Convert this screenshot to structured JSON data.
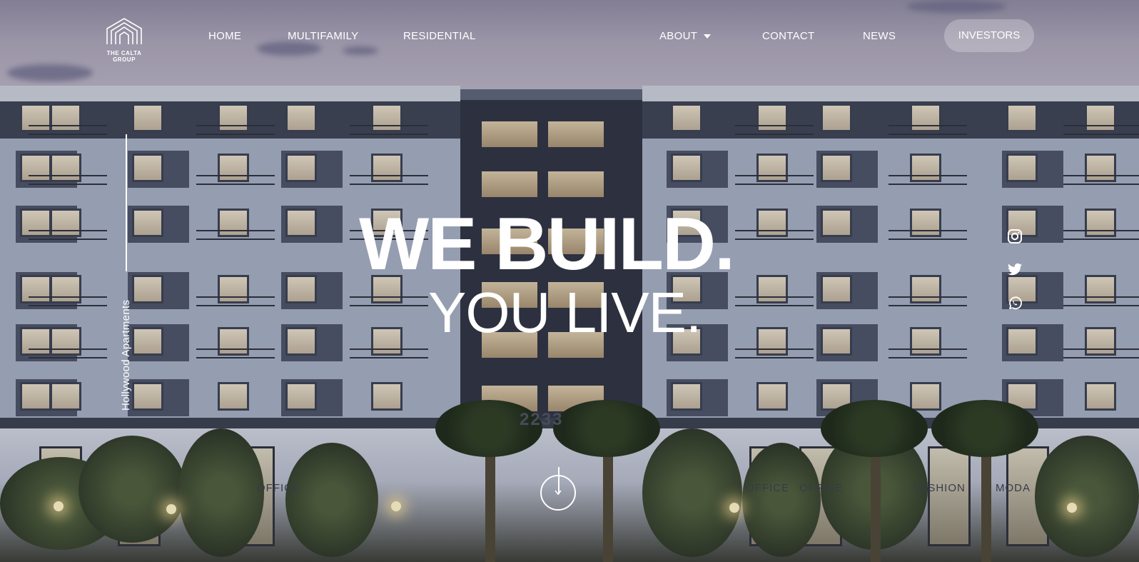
{
  "brand": {
    "name": "THE CALTA GROUP"
  },
  "nav": {
    "home": "HOME",
    "multifamily": "MULTIFAMILY",
    "residential": "RESIDENTIAL",
    "about": "ABOUT",
    "contact": "CONTACT",
    "news": "NEWS",
    "investors": "INVESTORS"
  },
  "hero": {
    "headline": "WE BUILD.",
    "subheadline": "YOU LIVE.",
    "property_label": "Hollywood Apartments",
    "building_number": "2233",
    "storefront_signs": [
      "OFFICE",
      "OFFICE",
      "OFFICE",
      "FASHION",
      "MODA"
    ]
  },
  "social": {
    "icons": [
      "instagram-icon",
      "twitter-icon",
      "whatsapp-icon"
    ]
  },
  "scroll": {
    "icon": "arrow-down-icon"
  },
  "colors": {
    "text": "#ffffff",
    "pill_bg": "rgba(255,255,255,0.25)"
  }
}
